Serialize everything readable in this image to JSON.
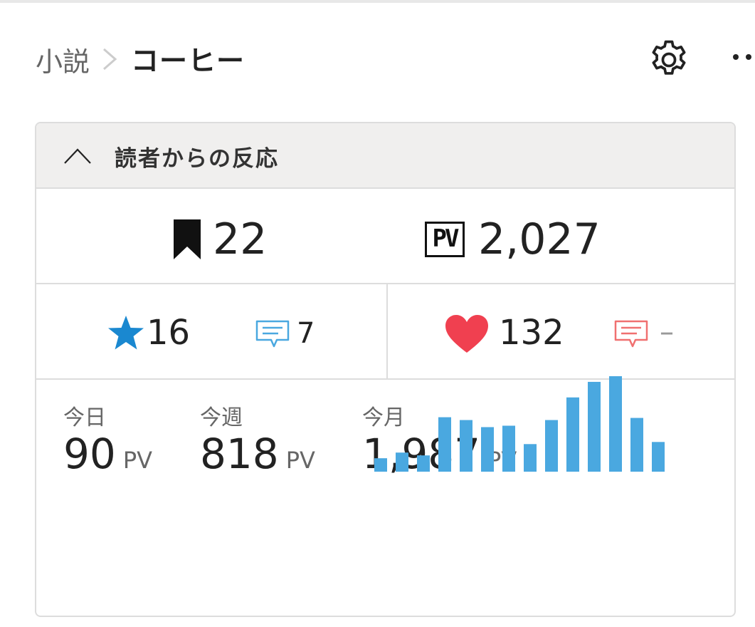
{
  "breadcrumb": {
    "parent": "小説",
    "current": "コーヒー"
  },
  "header_icons": {
    "settings": "gear-icon",
    "more": "more-icon"
  },
  "reactions": {
    "title": "読者からの反応",
    "bookmarks": "22",
    "pv_badge": "PV",
    "pv_total": "2,027",
    "stars": "16",
    "reviews": "7",
    "hearts": "132",
    "comments": "–",
    "colors": {
      "star": "#1a88d0",
      "review_icon": "#4aa8e0",
      "heart": "#f04050",
      "comment_icon": "#f07070",
      "bars": "#4aa8e0"
    }
  },
  "pv_stats": {
    "today": {
      "label": "今日",
      "value": "90",
      "unit": "PV"
    },
    "week": {
      "label": "今週",
      "value": "818",
      "unit": "PV"
    },
    "month": {
      "label": "今月",
      "value": "1,987",
      "unit": "PV"
    }
  },
  "chart_data": {
    "type": "bar",
    "title": "",
    "xlabel": "",
    "ylabel": "",
    "values": [
      19,
      27,
      23,
      77,
      73,
      63,
      65,
      39,
      73,
      105,
      127,
      135,
      76,
      42
    ]
  }
}
